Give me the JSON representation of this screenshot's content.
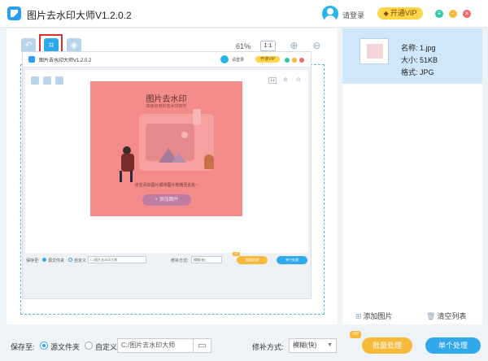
{
  "titlebar": {
    "title": "图片去水印大师V1.2.0.2",
    "login": "请登录",
    "vip": "开通VIP",
    "window_colors": [
      "#2dc6a6",
      "#f7b93a",
      "#f06a6a"
    ]
  },
  "toolbar": {
    "zoom": "61%",
    "ratio": "1:1",
    "icons": [
      "back-icon",
      "crop-icon",
      "eraser-icon",
      "zoom-in-icon",
      "zoom-out-icon"
    ]
  },
  "preview": {
    "title": "图片去水印大师V1.2.0.2",
    "login": "请登录",
    "vip": "开通VIP",
    "ratio": "1:1",
    "heading": "图片去水印",
    "subheading": "高级好用的去水印软件",
    "hint": "点击添加图片或将图片拖拽至此处~",
    "add_button": "+ 添加图片",
    "save_label": "保存至:",
    "source_folder": "源文件夹",
    "custom": "自定义",
    "path": "C:/图片去水印大师",
    "repair_label": "修补方式:",
    "repair_value": "模糊(快)",
    "vip_badge": "VIP",
    "batch": "批量处理",
    "single": "单个处理"
  },
  "file": {
    "name_label": "名称:",
    "name": "1.jpg",
    "size_label": "大小:",
    "size": "51KB",
    "format_label": "格式:",
    "format": "JPG"
  },
  "right_actions": {
    "add": "添加图片",
    "clear": "清空列表"
  },
  "bottom": {
    "save_label": "保存至:",
    "source_folder": "源文件夹",
    "custom": "自定义",
    "path": "C:/图片去水印大师",
    "repair_label": "修补方式:",
    "repair_value": "模糊(快)",
    "vip_badge": "VIP",
    "batch": "批量处理",
    "single": "单个处理"
  }
}
